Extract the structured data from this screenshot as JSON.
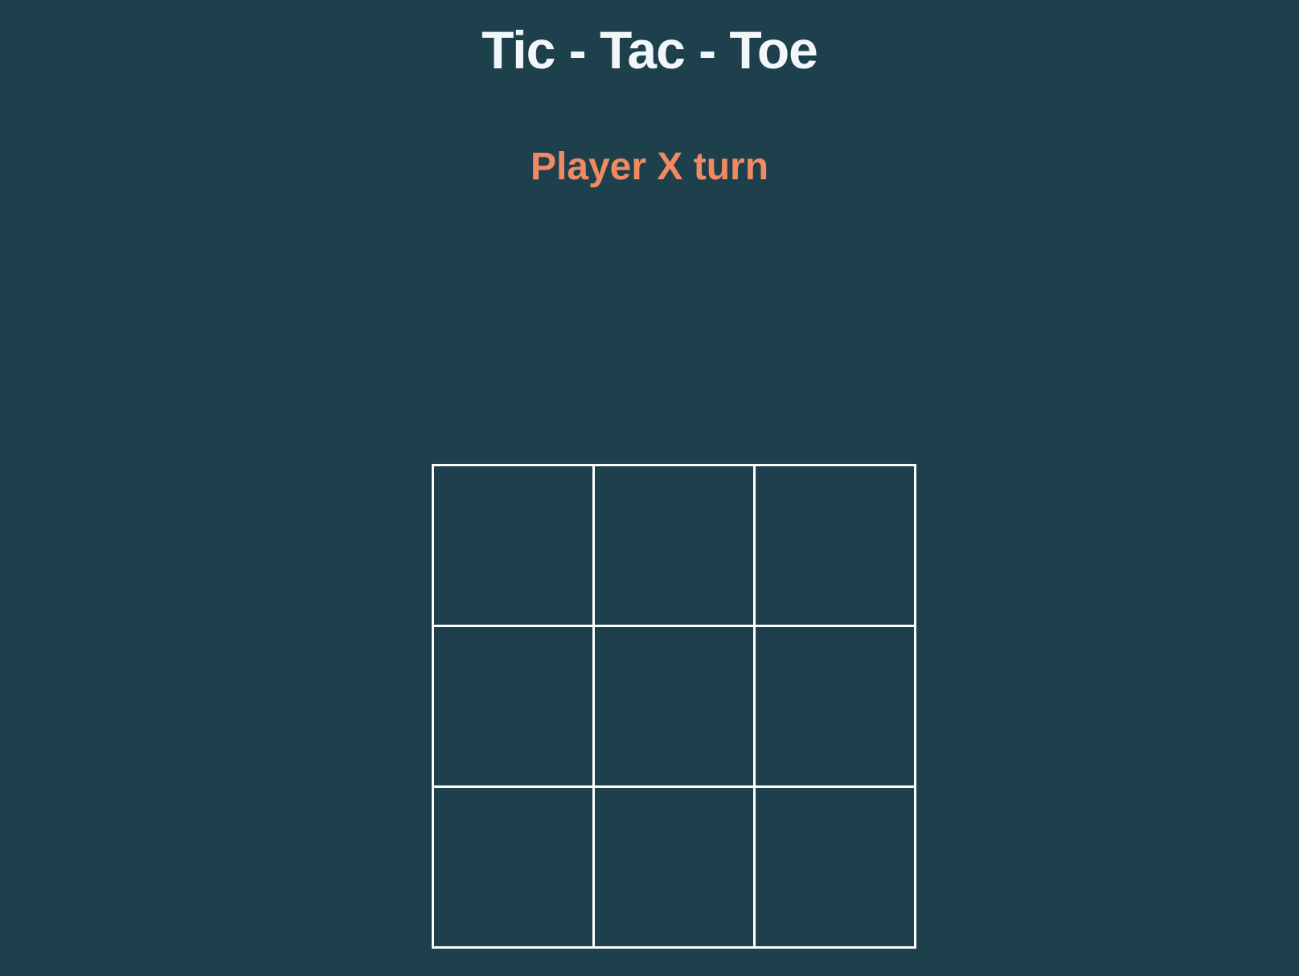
{
  "header": {
    "title": "Tic - Tac - Toe"
  },
  "status": {
    "text": "Player X turn"
  },
  "board": {
    "cells": [
      "",
      "",
      "",
      "",
      "",
      "",
      "",
      "",
      ""
    ]
  },
  "colors": {
    "background": "#1e404c",
    "title": "#f1f7fb",
    "status": "#ef8a62",
    "grid": "#ffffff"
  }
}
